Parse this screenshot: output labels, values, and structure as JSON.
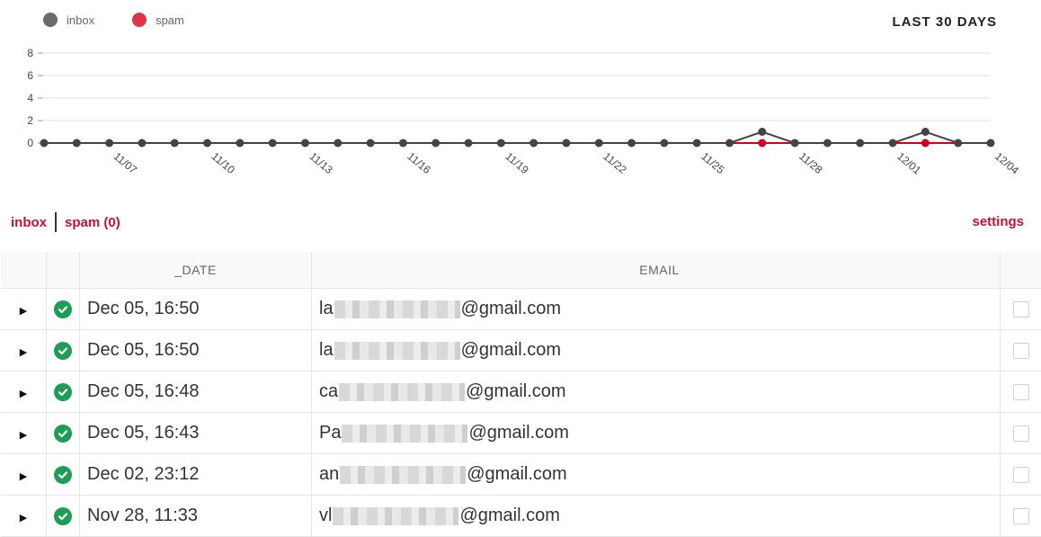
{
  "legend": [
    {
      "label": "inbox",
      "color": "#6b6b6b"
    },
    {
      "label": "spam",
      "color": "#dc3545"
    }
  ],
  "range_label": "LAST 30 DAYS",
  "chart_data": {
    "type": "line",
    "x": [
      "11/05",
      "11/06",
      "11/07",
      "11/08",
      "11/09",
      "11/10",
      "11/11",
      "11/12",
      "11/13",
      "11/14",
      "11/15",
      "11/16",
      "11/17",
      "11/18",
      "11/19",
      "11/20",
      "11/21",
      "11/22",
      "11/23",
      "11/24",
      "11/25",
      "11/26",
      "11/27",
      "11/28",
      "11/29",
      "11/30",
      "12/01",
      "12/02",
      "12/03",
      "12/04"
    ],
    "tick_labels": [
      "11/07",
      "11/10",
      "11/13",
      "11/16",
      "11/19",
      "11/22",
      "11/25",
      "11/28",
      "12/01",
      "12/04"
    ],
    "y_ticks": [
      0,
      2,
      4,
      6,
      8
    ],
    "ylim": [
      0,
      8
    ],
    "grid": true,
    "series": [
      {
        "name": "inbox",
        "color": "#444444",
        "values": [
          0,
          0,
          0,
          0,
          0,
          0,
          0,
          0,
          0,
          0,
          0,
          0,
          0,
          0,
          0,
          0,
          0,
          0,
          0,
          0,
          0,
          0,
          1,
          0,
          0,
          0,
          0,
          1,
          0,
          0
        ]
      },
      {
        "name": "spam",
        "color": "#d0021b",
        "values": [
          0,
          0,
          0,
          0,
          0,
          0,
          0,
          0,
          0,
          0,
          0,
          0,
          0,
          0,
          0,
          0,
          0,
          0,
          0,
          0,
          0,
          0,
          0,
          0,
          0,
          0,
          0,
          0,
          0,
          0
        ]
      }
    ]
  },
  "filters": {
    "inbox": "inbox",
    "spam": "spam (0)"
  },
  "settings": "settings",
  "table": {
    "headers": {
      "date": "_DATE",
      "email": "EMAIL"
    },
    "rows": [
      {
        "date": "Dec 05, 16:50",
        "email_prefix": "la",
        "email_domain": "@gmail.com"
      },
      {
        "date": "Dec 05, 16:50",
        "email_prefix": "la",
        "email_domain": "@gmail.com"
      },
      {
        "date": "Dec 05, 16:48",
        "email_prefix": "ca",
        "email_domain": "@gmail.com"
      },
      {
        "date": "Dec 05, 16:43",
        "email_prefix": "Pa",
        "email_domain": "@gmail.com"
      },
      {
        "date": "Dec 02, 23:12",
        "email_prefix": "an",
        "email_domain": "@gmail.com"
      },
      {
        "date": "Nov 28, 11:33",
        "email_prefix": "vl",
        "email_domain": "@gmail.com"
      }
    ]
  }
}
